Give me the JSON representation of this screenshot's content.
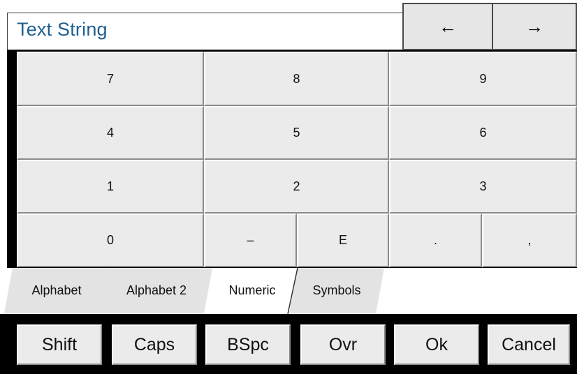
{
  "title": "Text String",
  "nav": {
    "left_arrow": "←",
    "right_arrow": "→"
  },
  "keys": {
    "row1": [
      "7",
      "8",
      "9"
    ],
    "row2": [
      "4",
      "5",
      "6"
    ],
    "row3": [
      "1",
      "2",
      "3"
    ],
    "row4": [
      "0",
      "–",
      "E",
      ".",
      ","
    ]
  },
  "tabs": [
    {
      "label": "Alphabet",
      "active": false
    },
    {
      "label": "Alphabet 2",
      "active": false
    },
    {
      "label": "Numeric",
      "active": true
    },
    {
      "label": "Symbols",
      "active": false
    }
  ],
  "function_keys": [
    "Shift",
    "Caps",
    "BSpc",
    "Ovr",
    "Ok",
    "Cancel"
  ],
  "colors": {
    "title_text": "#1f5f8f",
    "key_face": "#ebebeb",
    "panel_background": "#000000"
  }
}
